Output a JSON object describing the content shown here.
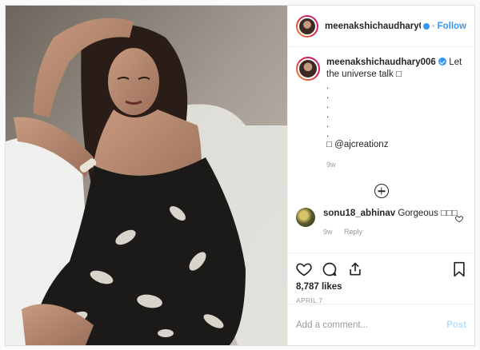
{
  "post": {
    "author": "meenakshichaudhary006",
    "header_separator": "•",
    "follow_label": "Follow",
    "caption": {
      "username": "meenakshichaudhary006",
      "text": "Let the universe talk",
      "symbol": "□",
      "dots": [
        ".",
        ".",
        ".",
        ".",
        ".",
        "."
      ],
      "mention_prefix": "□",
      "mention": "@ajcreationz",
      "age": "9w"
    },
    "comments": [
      {
        "username": "sonu18_abhinav",
        "text": "Gorgeous □□□",
        "age": "9w",
        "reply_label": "Reply"
      }
    ],
    "likes": "8,787 likes",
    "date": "APRIL 7",
    "add_comment_placeholder": "Add a comment...",
    "post_label": "Post"
  },
  "icons": {
    "avatar": "avatar-icon",
    "verified": "verified-badge-icon",
    "load_more": "plus-circle-icon",
    "like": "heart-icon",
    "comment": "speech-bubble-icon",
    "share": "share-icon",
    "save": "bookmark-icon"
  },
  "colors": {
    "link_blue": "#3897f0",
    "post_disabled": "#b2dffc",
    "muted": "#999999"
  }
}
